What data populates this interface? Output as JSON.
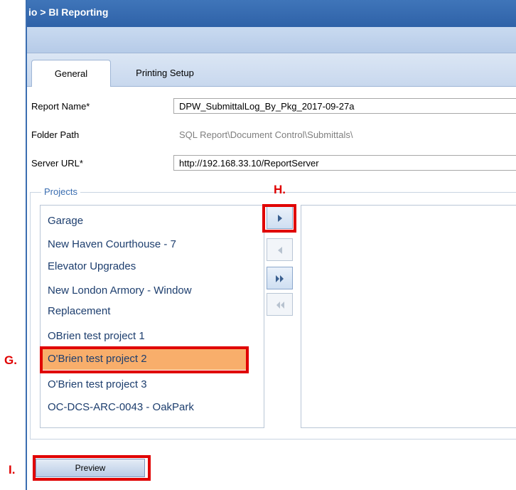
{
  "window": {
    "title": "io > BI Reporting"
  },
  "tabs": [
    {
      "label": "General",
      "active": true
    },
    {
      "label": "Printing Setup",
      "active": false
    }
  ],
  "fields": {
    "report_name": {
      "label": "Report Name*",
      "value": "DPW_SubmittalLog_By_Pkg_2017-09-27a"
    },
    "folder_path": {
      "label": "Folder Path",
      "value": "SQL Report\\Document Control\\Submittals\\"
    },
    "server_url": {
      "label": "Server URL*",
      "value": "http://192.168.33.10/ReportServer"
    }
  },
  "projects": {
    "legend": "Projects",
    "items": [
      "Garage",
      "New Haven Courthouse - 7",
      "Elevator Upgrades",
      "New London Armory - Window",
      "Replacement",
      "OBrien test project 1",
      "O'Brien test project 2",
      "O'Brien test project 3",
      "OC-DCS-ARC-0043 - OakPark"
    ],
    "selected_index": 6,
    "move_buttons": [
      {
        "name": "move-right",
        "icon": "single-right-arrow",
        "enabled": true
      },
      {
        "name": "move-left",
        "icon": "single-left-arrow",
        "enabled": false
      },
      {
        "name": "move-all-right",
        "icon": "double-right-arrow",
        "enabled": true
      },
      {
        "name": "move-all-left",
        "icon": "double-left-arrow",
        "enabled": false
      }
    ]
  },
  "annotations": {
    "g": "G.",
    "h": "H.",
    "i": "I."
  },
  "buttons": {
    "preview": "Preview"
  },
  "colors": {
    "header_blue": "#3f75b9",
    "selected_item": "#f8ae6b",
    "annotation_red": "#e00000",
    "list_text": "#1d3e6e"
  }
}
